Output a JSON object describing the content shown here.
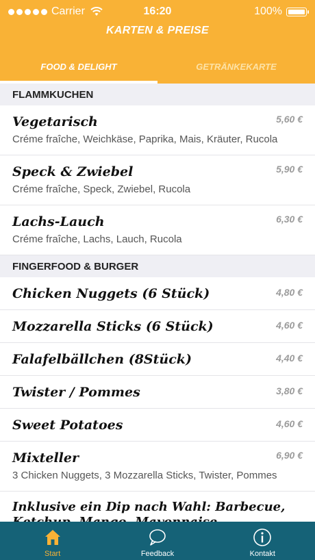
{
  "status": {
    "carrier": "Carrier",
    "time": "16:20",
    "battery": "100%"
  },
  "header": {
    "title": "Karten & Preise"
  },
  "tabs": [
    {
      "label": "Food & Delight",
      "active": true
    },
    {
      "label": "Getränkekarte",
      "active": false
    }
  ],
  "sections": [
    {
      "title": "FLAMMKUCHEN",
      "items": [
        {
          "name": "Vegetarisch",
          "price": "5,60 €",
          "desc": "Créme fraîche, Weichkäse, Paprika, Mais, Kräuter, Rucola"
        },
        {
          "name": "Speck & Zwiebel",
          "price": "5,90 €",
          "desc": "Créme fraîche, Speck, Zwiebel, Rucola"
        },
        {
          "name": "Lachs-Lauch",
          "price": "6,30 €",
          "desc": "Créme fraîche, Lachs, Lauch, Rucola"
        }
      ]
    },
    {
      "title": "FINGERFOOD & BURGER",
      "items": [
        {
          "name": "Chicken Nuggets (6 Stück)",
          "price": "4,80 €"
        },
        {
          "name": "Mozzarella Sticks (6 Stück)",
          "price": "4,60 €"
        },
        {
          "name": "Falafelbällchen (8Stück)",
          "price": "4,40 €"
        },
        {
          "name": "Twister / Pommes",
          "price": "3,80 €"
        },
        {
          "name": "Sweet Potatoes",
          "price": "4,60 €"
        },
        {
          "name": "Mixteller",
          "price": "6,90 €",
          "desc": "3 Chicken Nuggets, 3 Mozzarella Sticks, Twister, Pommes"
        },
        {
          "name": "Inklusive ein Dip nach Wahl: Barbecue, Ketchup, Mango, Mayonnaise, Remoulade, Sauerrahm oder Süß-"
        }
      ]
    }
  ],
  "tabbar": [
    {
      "label": "Start",
      "icon": "home-icon",
      "active": true
    },
    {
      "label": "Feedback",
      "icon": "speech-bubble-icon",
      "active": false
    },
    {
      "label": "Kontakt",
      "icon": "info-icon",
      "active": false
    }
  ],
  "colors": {
    "accent": "#f9b236",
    "tabbar": "#156277",
    "section_bg": "#efeff4",
    "price": "#9b9b9b"
  }
}
